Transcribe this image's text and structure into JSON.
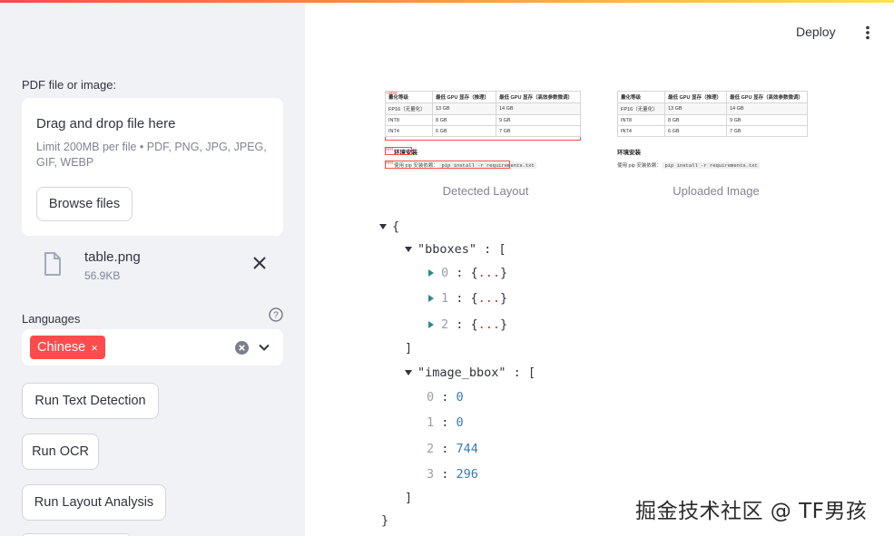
{
  "app": {
    "deploy_label": "Deploy",
    "accent_color": "#ff4b4b"
  },
  "sidebar": {
    "upload_label": "PDF file or image:",
    "dropzone_title": "Drag and drop file here",
    "dropzone_hint": "Limit 200MB per file • PDF, PNG, JPG, JPEG, GIF, WEBP",
    "browse_label": "Browse files",
    "file": {
      "name": "table.png",
      "size": "56.9KB",
      "icon": "file-icon"
    },
    "languages_label": "Languages",
    "selected_language": "Chinese",
    "chip_remove": "×",
    "buttons": [
      "Run Text Detection",
      "Run OCR",
      "Run Layout Analysis"
    ]
  },
  "images": {
    "detected_caption": "Detected Layout",
    "uploaded_caption": "Uploaded Image",
    "table": {
      "header": [
        "量化等级",
        "最低 GPU 显存（推理）",
        "最低 GPU 显存（高效参数微调）"
      ],
      "rows": [
        [
          "FP16（无量化）",
          "13 GB",
          "14 GB"
        ],
        [
          "INT8",
          "8 GB",
          "9 GB"
        ],
        [
          "INT4",
          "6 GB",
          "7 GB"
        ]
      ]
    },
    "section_heading": "环境安装",
    "install_prefix": "使用 pip 安装依赖：",
    "install_code": "pip install -r requirements.txt",
    "box_labels": {
      "table": "Table",
      "text": "Text"
    }
  },
  "json_view": {
    "open_brace": "{",
    "close_brace": "}",
    "bboxes_key": "\"bboxes\"",
    "bboxes_items": [
      "0",
      "1",
      "2"
    ],
    "collapsed": "...",
    "image_bbox_key": "\"image_bbox\"",
    "image_bbox": [
      {
        "index": "0",
        "value": "0"
      },
      {
        "index": "1",
        "value": "0"
      },
      {
        "index": "2",
        "value": "744"
      },
      {
        "index": "3",
        "value": "296"
      }
    ]
  },
  "watermark": "掘金技术社区 @ TF男孩"
}
